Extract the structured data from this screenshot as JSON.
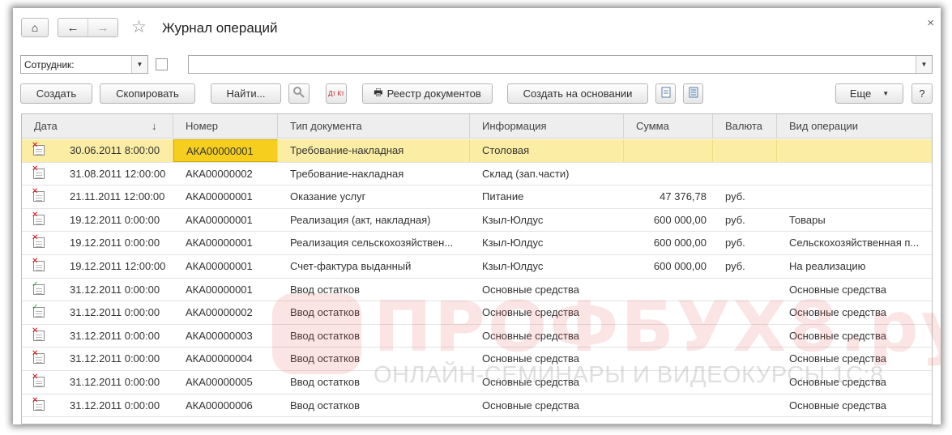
{
  "window": {
    "title": "Журнал операций",
    "close_glyph": "×"
  },
  "nav": {
    "home_glyph": "⌂",
    "back_glyph": "←",
    "forward_glyph": "→",
    "star_glyph": "☆"
  },
  "filter": {
    "employee_label": "Сотрудник:",
    "employee_value": "",
    "search_value": ""
  },
  "toolbar": {
    "create": "Создать",
    "copy": "Скопировать",
    "find": "Найти...",
    "registry": "Реестр документов",
    "create_based": "Создать на основании",
    "more": "Еще",
    "help": "?",
    "dt_kt": "Дт Кт"
  },
  "table": {
    "columns": [
      "Дата",
      "Номер",
      "Тип документа",
      "Информация",
      "Сумма",
      "Валюта",
      "Вид операции"
    ],
    "sort_glyph": "↓",
    "rows": [
      {
        "status": "del",
        "date": "30.06.2011 8:00:00",
        "number": "АКА00000001",
        "type": "Требование-накладная",
        "info": "Столовая",
        "sum": "",
        "currency": "",
        "operation": ""
      },
      {
        "status": "del",
        "date": "31.08.2011 12:00:00",
        "number": "АКА00000002",
        "type": "Требование-накладная",
        "info": "Склад (зап.части)",
        "sum": "",
        "currency": "",
        "operation": ""
      },
      {
        "status": "del",
        "date": "21.11.2011 12:00:00",
        "number": "АКА00000001",
        "type": "Оказание услуг",
        "info": "Питание",
        "sum": "47 376,78",
        "currency": "руб.",
        "operation": ""
      },
      {
        "status": "del",
        "date": "19.12.2011 0:00:00",
        "number": "АКА00000001",
        "type": "Реализация (акт, накладная)",
        "info": "Кзыл-Юлдус",
        "sum": "600 000,00",
        "currency": "руб.",
        "operation": "Товары"
      },
      {
        "status": "del",
        "date": "19.12.2011 0:00:00",
        "number": "АКА00000001",
        "type": "Реализация сельскохозяйствен...",
        "info": "Кзыл-Юлдус",
        "sum": "600 000,00",
        "currency": "руб.",
        "operation": "Сельскохозяйственная п..."
      },
      {
        "status": "del",
        "date": "19.12.2011 12:00:00",
        "number": "АКА00000001",
        "type": "Счет-фактура выданный",
        "info": "Кзыл-Юлдус",
        "sum": "600 000,00",
        "currency": "руб.",
        "operation": "На реализацию"
      },
      {
        "status": "ok",
        "date": "31.12.2011 0:00:00",
        "number": "АКА00000001",
        "type": "Ввод остатков",
        "info": "Основные средства",
        "sum": "",
        "currency": "",
        "operation": "Основные средства"
      },
      {
        "status": "ok",
        "date": "31.12.2011 0:00:00",
        "number": "АКА00000002",
        "type": "Ввод остатков",
        "info": "Основные средства",
        "sum": "",
        "currency": "",
        "operation": "Основные средства"
      },
      {
        "status": "del",
        "date": "31.12.2011 0:00:00",
        "number": "АКА00000003",
        "type": "Ввод остатков",
        "info": "Основные средства",
        "sum": "",
        "currency": "",
        "operation": "Основные средства"
      },
      {
        "status": "del",
        "date": "31.12.2011 0:00:00",
        "number": "АКА00000004",
        "type": "Ввод остатков",
        "info": "Основные средства",
        "sum": "",
        "currency": "",
        "operation": "Основные средства"
      },
      {
        "status": "del",
        "date": "31.12.2011 0:00:00",
        "number": "АКА00000005",
        "type": "Ввод остатков",
        "info": "Основные средства",
        "sum": "",
        "currency": "",
        "operation": "Основные средства"
      },
      {
        "status": "del",
        "date": "31.12.2011 0:00:00",
        "number": "АКА00000006",
        "type": "Ввод остатков",
        "info": "Основные средства",
        "sum": "",
        "currency": "",
        "operation": "Основные средства"
      }
    ],
    "selected_row": 0
  },
  "watermark": {
    "brand": "ПРОФБУХ8.ру",
    "tagline": "ОНЛАЙН-СЕМИНАРЫ И ВИДЕОКУРСЫ 1С:8"
  },
  "colors": {
    "selected_row": "#fbeea4",
    "focused_cell": "#f6cf1e",
    "header_bg": "#eeeeee",
    "delete_mark": "#d01010",
    "posted_mark": "#2a9c2a"
  }
}
